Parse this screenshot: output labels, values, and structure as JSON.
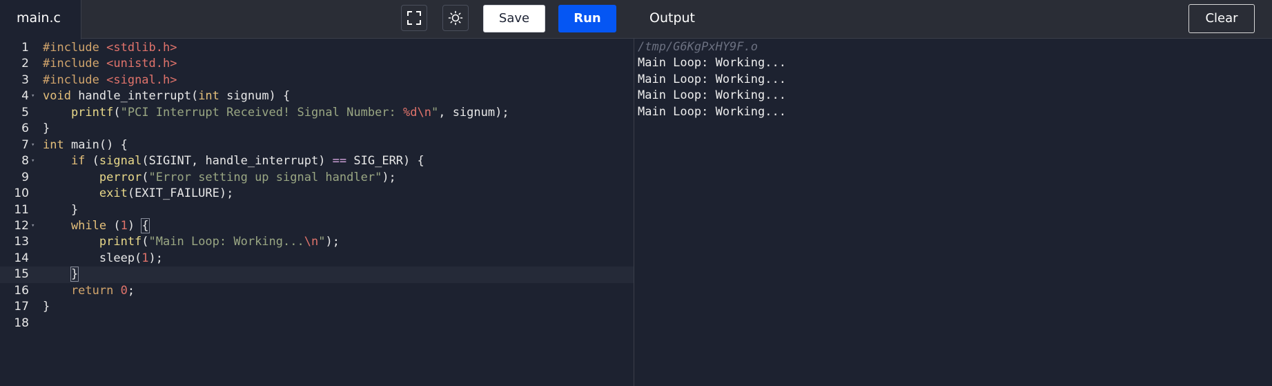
{
  "header": {
    "file_tab": "main.c",
    "save_label": "Save",
    "run_label": "Run",
    "output_title": "Output",
    "clear_label": "Clear",
    "icons": [
      "expand-icon",
      "sun-icon"
    ]
  },
  "editor": {
    "line_numbers": [
      "1",
      "2",
      "3",
      "4",
      "5",
      "6",
      "7",
      "8",
      "9",
      "10",
      "11",
      "12",
      "13",
      "14",
      "15",
      "16",
      "17",
      "18"
    ],
    "fold_markers": [
      4,
      7,
      8,
      12
    ],
    "active_line": 15,
    "lines": [
      [
        {
          "t": "#include ",
          "c": "pre"
        },
        {
          "t": "<stdlib.h>",
          "c": "hdr"
        }
      ],
      [
        {
          "t": "#include ",
          "c": "pre"
        },
        {
          "t": "<unistd.h>",
          "c": "hdr"
        }
      ],
      [
        {
          "t": "#include ",
          "c": "pre"
        },
        {
          "t": "<signal.h>",
          "c": "hdr"
        }
      ],
      [
        {
          "t": "void ",
          "c": "kw"
        },
        {
          "t": "handle_interrupt(",
          "c": "plain"
        },
        {
          "t": "int",
          "c": "kw"
        },
        {
          "t": " signum) {",
          "c": "plain"
        }
      ],
      [
        {
          "t": "    printf",
          "c": "fn"
        },
        {
          "t": "(",
          "c": "plain"
        },
        {
          "t": "\"PCI Interrupt Received! Signal Number: ",
          "c": "str"
        },
        {
          "t": "%d\\n",
          "c": "esc"
        },
        {
          "t": "\"",
          "c": "str"
        },
        {
          "t": ", signum);",
          "c": "plain"
        }
      ],
      [
        {
          "t": "}",
          "c": "plain"
        }
      ],
      [
        {
          "t": "int",
          "c": "kw"
        },
        {
          "t": " main() {",
          "c": "plain"
        }
      ],
      [
        {
          "t": "    if",
          "c": "kw"
        },
        {
          "t": " (",
          "c": "plain"
        },
        {
          "t": "signal",
          "c": "fn"
        },
        {
          "t": "(SIGINT, handle_interrupt) ",
          "c": "plain"
        },
        {
          "t": "==",
          "c": "op"
        },
        {
          "t": " SIG_ERR) {",
          "c": "plain"
        }
      ],
      [
        {
          "t": "        perror",
          "c": "fn"
        },
        {
          "t": "(",
          "c": "plain"
        },
        {
          "t": "\"Error setting up signal handler\"",
          "c": "str"
        },
        {
          "t": ");",
          "c": "plain"
        }
      ],
      [
        {
          "t": "        exit",
          "c": "fn"
        },
        {
          "t": "(EXIT_FAILURE);",
          "c": "plain"
        }
      ],
      [
        {
          "t": "    }",
          "c": "plain"
        }
      ],
      [
        {
          "t": "    while",
          "c": "kw"
        },
        {
          "t": " (",
          "c": "plain"
        },
        {
          "t": "1",
          "c": "num"
        },
        {
          "t": ") ",
          "c": "plain"
        },
        {
          "t": "{",
          "c": "plain",
          "box": true
        }
      ],
      [
        {
          "t": "        printf",
          "c": "fn"
        },
        {
          "t": "(",
          "c": "plain"
        },
        {
          "t": "\"Main Loop: Working...",
          "c": "str"
        },
        {
          "t": "\\n",
          "c": "esc"
        },
        {
          "t": "\"",
          "c": "str"
        },
        {
          "t": ");",
          "c": "plain"
        }
      ],
      [
        {
          "t": "        sleep(",
          "c": "plain"
        },
        {
          "t": "1",
          "c": "num"
        },
        {
          "t": ");",
          "c": "plain"
        }
      ],
      [
        {
          "t": "    ",
          "c": "plain"
        },
        {
          "t": "}",
          "c": "plain",
          "box": true
        }
      ],
      [
        {
          "t": "    return ",
          "c": "ret"
        },
        {
          "t": "0",
          "c": "num"
        },
        {
          "t": ";",
          "c": "plain"
        }
      ],
      [
        {
          "t": "}",
          "c": "plain"
        }
      ],
      []
    ]
  },
  "output": {
    "path": "/tmp/G6KgPxHY9F.o",
    "lines": [
      "Main Loop: Working...",
      "Main Loop: Working...",
      "Main Loop: Working...",
      "Main Loop: Working..."
    ]
  }
}
